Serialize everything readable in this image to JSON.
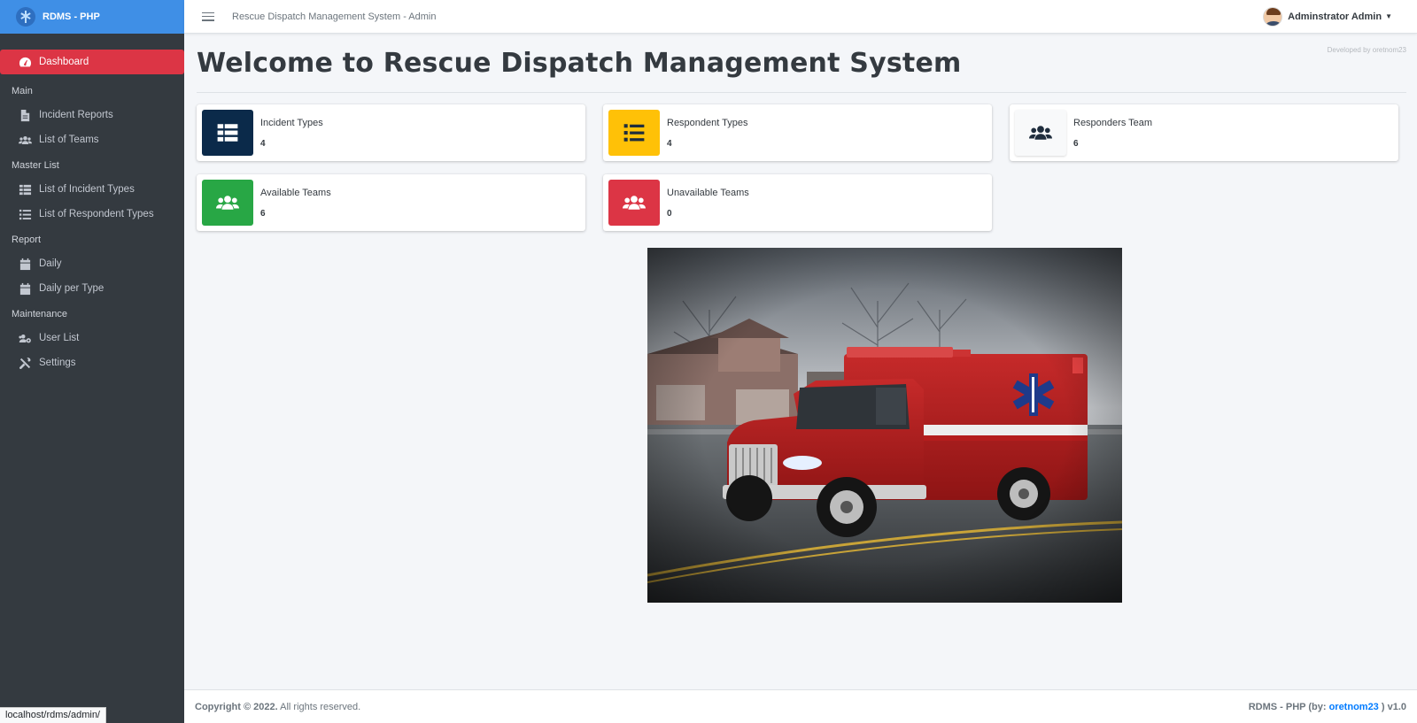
{
  "brand": {
    "name": "RDMS - PHP"
  },
  "topbar": {
    "title": "Rescue Dispatch Management System - Admin",
    "user_name": "Adminstrator Admin"
  },
  "sidebar": {
    "dashboard": "Dashboard",
    "main_header": "Main",
    "incident_reports": "Incident Reports",
    "list_of_teams": "List of Teams",
    "master_header": "Master List",
    "incident_types": "List of Incident Types",
    "respondent_types": "List of Respondent Types",
    "report_header": "Report",
    "daily": "Daily",
    "daily_per_type": "Daily per Type",
    "maintenance_header": "Maintenance",
    "user_list": "User List",
    "settings": "Settings"
  },
  "status_url": "localhost/rdms/admin/",
  "main": {
    "dev_credit": "Developed by oretnom23",
    "title": "Welcome to Rescue Dispatch Management System"
  },
  "cards": [
    {
      "label": "Incident Types",
      "value": "4",
      "color": "#001f3f",
      "icon": "table-icon"
    },
    {
      "label": "Respondent Types",
      "value": "4",
      "color": "#ffc107",
      "icon": "list-icon"
    },
    {
      "label": "Responders Team",
      "value": "6",
      "color": "#f8f9fa",
      "icon": "users-icon"
    },
    {
      "label": "Available Teams",
      "value": "6",
      "color": "#28a745",
      "icon": "users-icon"
    },
    {
      "label": "Unavailable Teams",
      "value": "0",
      "color": "#dc3545",
      "icon": "users-icon"
    }
  ],
  "footer": {
    "copyright": "Copyright © 2022.",
    "rights": " All rights reserved.",
    "app_prefix": "RDMS - PHP (by: ",
    "author": "oretnom23",
    "version_suffix": " ) v1.0"
  }
}
